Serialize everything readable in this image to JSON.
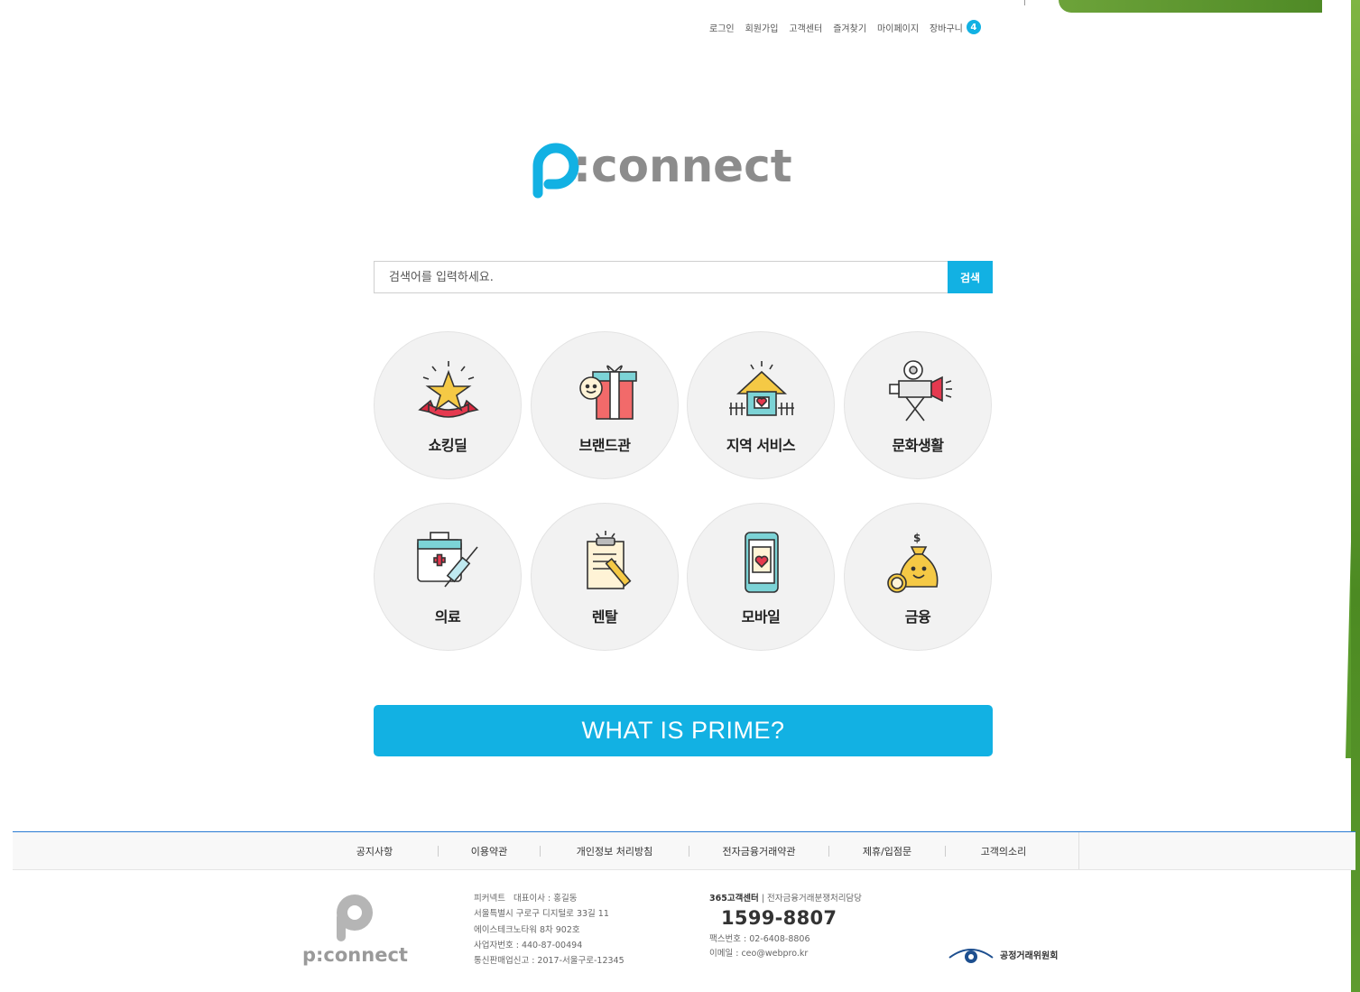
{
  "top_nav": {
    "login": "로그인",
    "signup": "회원가입",
    "customer_center": "고객센터",
    "bookmark": "즐겨찾기",
    "mypage": "마이페이지",
    "cart": "장바구니",
    "cart_count": "4"
  },
  "logo_text": "p:connect",
  "search": {
    "placeholder": "검색어를 입력하세요.",
    "button": "검색"
  },
  "categories": [
    {
      "label": "쇼킹딜",
      "icon": "star-ribbon-icon"
    },
    {
      "label": "브랜드관",
      "icon": "gift-box-icon"
    },
    {
      "label": "지역 서비스",
      "icon": "house-heart-icon"
    },
    {
      "label": "문화생활",
      "icon": "movie-projector-icon"
    },
    {
      "label": "의료",
      "icon": "medical-kit-icon"
    },
    {
      "label": "렌탈",
      "icon": "clipboard-pencil-icon"
    },
    {
      "label": "모바일",
      "icon": "smartphone-heart-icon"
    },
    {
      "label": "금융",
      "icon": "money-bag-icon"
    }
  ],
  "prime_banner": "WHAT IS PRIME?",
  "footer": {
    "links": [
      "공지사항",
      "이용약관",
      "개인정보 처리방침",
      "전자금융거래약관",
      "제휴/입점문",
      "고객의소리"
    ],
    "company": {
      "line1": "피커넥트   대표이사 : 홍길동",
      "line2": "서울특별시 구로구 디지털로 33길 11",
      "line3": "에이스테크노타워 8차 902호",
      "line4": "사업자번호 : 440-87-00494",
      "line5": "통신판매업신고 : 2017-서울구로-12345"
    },
    "cs": {
      "title_bold": "365고객센터",
      "title_rest": " | 전자금융거래분쟁처리담당",
      "phone": "1599-8807",
      "fax": "팩스번호 : 02-6408-8806",
      "email": "이메일 : ceo@webpro.kr"
    },
    "ftc": "공정거래위원회"
  },
  "colors": {
    "accent": "#12b1e3",
    "logo_gray": "#8c8c8c",
    "deco_green": "#5e9b2f"
  }
}
